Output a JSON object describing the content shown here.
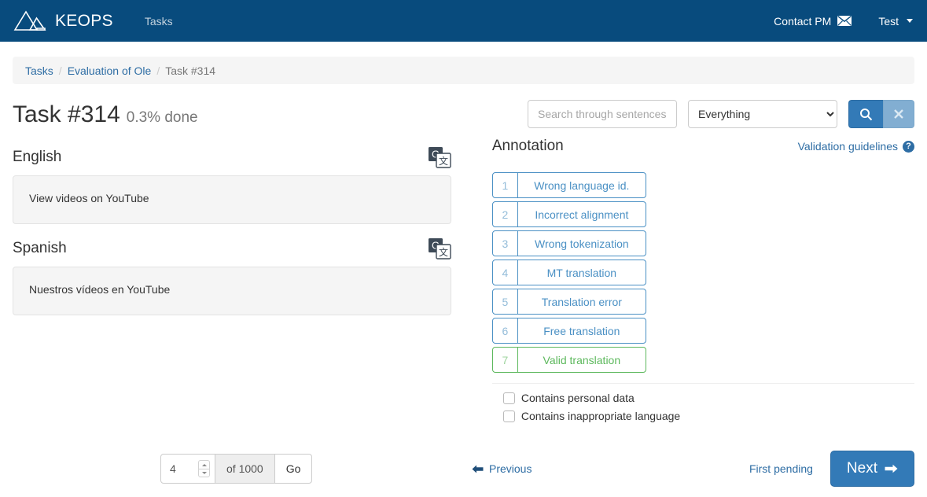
{
  "navbar": {
    "logo_name": "pyramids-logo-icon",
    "brand": "KEOPS",
    "links": [
      {
        "label": "Tasks",
        "name": "nav-link-tasks"
      }
    ],
    "contact": {
      "label": "Contact PM",
      "icon": "envelope-icon"
    },
    "user": {
      "label": "Test",
      "icon": "caret-down-icon"
    },
    "bg_color": "#084b7d"
  },
  "breadcrumb": {
    "items": [
      {
        "label": "Tasks",
        "active": false
      },
      {
        "label": "Evaluation of Ole",
        "active": false
      },
      {
        "label": "Task #314",
        "active": true
      }
    ],
    "separator": "/"
  },
  "header": {
    "title": "Task #314",
    "progress": "0.3% done"
  },
  "search": {
    "placeholder": "Search through sentences",
    "value": "",
    "scope_selected": "Everything",
    "scope_options": [
      "Everything"
    ],
    "search_icon": "magnifier-icon",
    "clear_icon": "times-icon",
    "search_color": "#337ab7",
    "clear_color": "#82aed2"
  },
  "segments": [
    {
      "language": "English",
      "text": "View videos on YouTube",
      "translate_icon": "google-translate-icon"
    },
    {
      "language": "Spanish",
      "text": "Nuestros vídeos en YouTube",
      "translate_icon": "google-translate-icon"
    }
  ],
  "annotation": {
    "title": "Annotation",
    "guidelines_label": "Validation guidelines",
    "guidelines_icon": "help-circle-icon",
    "options": [
      {
        "num": "1",
        "label": "Wrong language id.",
        "valid": false
      },
      {
        "num": "2",
        "label": "Incorrect alignment",
        "valid": false
      },
      {
        "num": "3",
        "label": "Wrong tokenization",
        "valid": false
      },
      {
        "num": "4",
        "label": "MT translation",
        "valid": false
      },
      {
        "num": "5",
        "label": "Translation error",
        "valid": false
      },
      {
        "num": "6",
        "label": "Free translation",
        "valid": false
      },
      {
        "num": "7",
        "label": "Valid translation",
        "valid": true
      }
    ],
    "checkboxes": [
      {
        "label": "Contains personal data",
        "checked": false
      },
      {
        "label": "Contains inappropriate language",
        "checked": false
      }
    ],
    "blue": "#4a90c4",
    "green": "#5cb85c"
  },
  "footer": {
    "page_value": "4",
    "of_label": "of 1000",
    "go_label": "Go",
    "previous_label": "Previous",
    "previous_icon": "arrow-left-icon",
    "first_pending_label": "First pending",
    "next_label": "Next",
    "next_icon": "arrow-right-icon"
  }
}
